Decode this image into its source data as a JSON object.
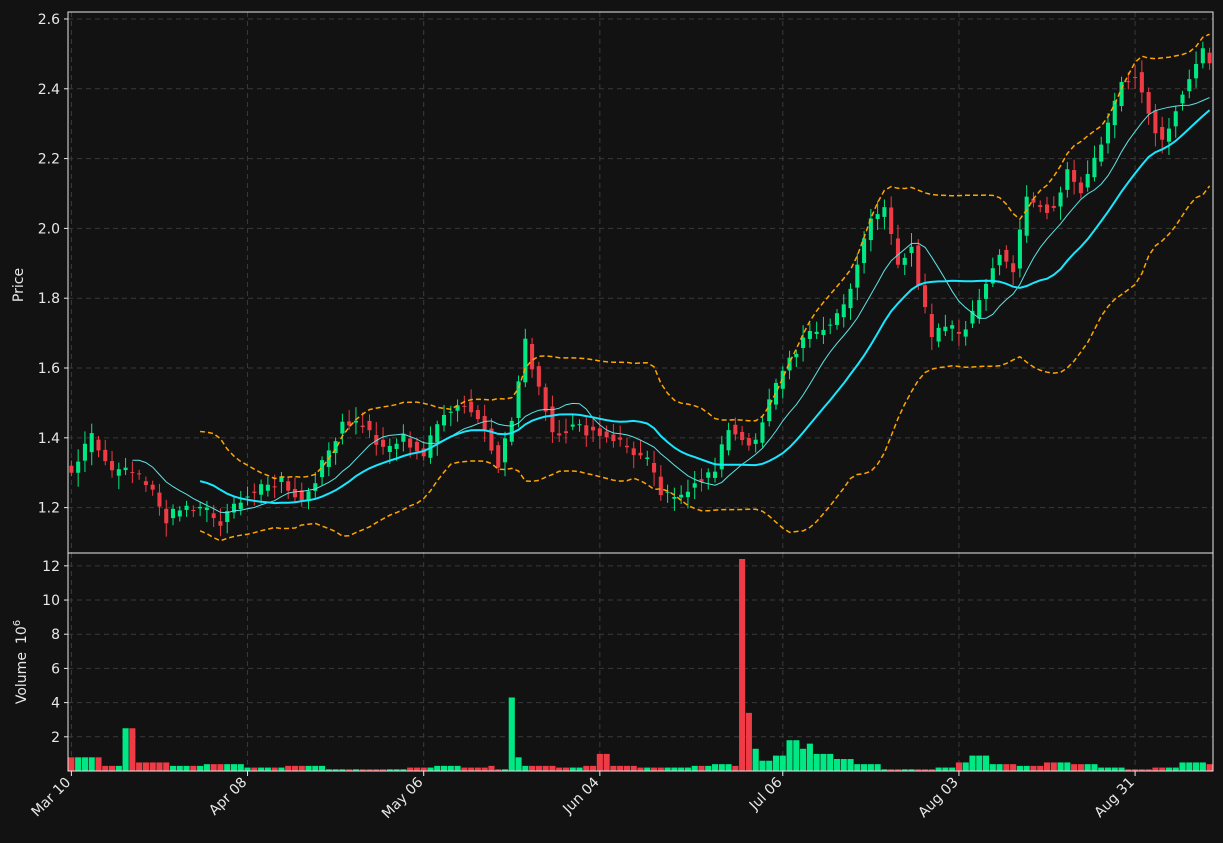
{
  "chart_data": {
    "type": "candlestick",
    "x_tick_labels": [
      "Mar 10",
      "Apr 08",
      "May 06",
      "Jun 04",
      "Jul 06",
      "Aug 03",
      "Aug 31"
    ],
    "price_panel": {
      "ylabel": "Price",
      "ylim": [
        1.07,
        2.62
      ],
      "yticks": [
        1.2,
        1.4,
        1.6,
        1.8,
        2.0,
        2.2,
        2.4,
        2.6
      ],
      "grid": true
    },
    "volume_panel": {
      "ylabel": "Volume",
      "scale_label": "10",
      "scale_exponent": "6",
      "ylim": [
        0,
        12.4
      ],
      "yticks": [
        2,
        4,
        6,
        8,
        10,
        12
      ],
      "grid": true
    },
    "colors": {
      "background": "#121212",
      "up": "#00e884",
      "down": "#ef3b45",
      "ma_fast": "#5ce4e4",
      "ma_slow": "#18e7ff",
      "bollinger": "#ffa500",
      "grid": "#3a3a3a",
      "axis": "#e8e8e8"
    },
    "anchors": {
      "close": [
        [
          0,
          1.3
        ],
        [
          3,
          1.4
        ],
        [
          6,
          1.3
        ],
        [
          9,
          1.3
        ],
        [
          12,
          1.24
        ],
        [
          14,
          1.17
        ],
        [
          17,
          1.2
        ],
        [
          20,
          1.19
        ],
        [
          22,
          1.15
        ],
        [
          25,
          1.23
        ],
        [
          28,
          1.25
        ],
        [
          31,
          1.28
        ],
        [
          34,
          1.22
        ],
        [
          37,
          1.32
        ],
        [
          40,
          1.45
        ],
        [
          43,
          1.44
        ],
        [
          46,
          1.36
        ],
        [
          49,
          1.4
        ],
        [
          52,
          1.35
        ],
        [
          55,
          1.48
        ],
        [
          58,
          1.5
        ],
        [
          61,
          1.43
        ],
        [
          63,
          1.33
        ],
        [
          65,
          1.45
        ],
        [
          67,
          1.67
        ],
        [
          69,
          1.55
        ],
        [
          71,
          1.42
        ],
        [
          74,
          1.43
        ],
        [
          77,
          1.42
        ],
        [
          80,
          1.4
        ],
        [
          83,
          1.36
        ],
        [
          85,
          1.33
        ],
        [
          87,
          1.24
        ],
        [
          89,
          1.22
        ],
        [
          92,
          1.28
        ],
        [
          95,
          1.3
        ],
        [
          97,
          1.43
        ],
        [
          99,
          1.4
        ],
        [
          101,
          1.38
        ],
        [
          103,
          1.5
        ],
        [
          105,
          1.6
        ],
        [
          108,
          1.68
        ],
        [
          110,
          1.7
        ],
        [
          112,
          1.73
        ],
        [
          114,
          1.78
        ],
        [
          116,
          1.9
        ],
        [
          118,
          2.02
        ],
        [
          120,
          2.06
        ],
        [
          122,
          1.9
        ],
        [
          124,
          1.96
        ],
        [
          125,
          1.84
        ],
        [
          127,
          1.68
        ],
        [
          129,
          1.72
        ],
        [
          131,
          1.7
        ],
        [
          133,
          1.75
        ],
        [
          135,
          1.85
        ],
        [
          137,
          1.94
        ],
        [
          139,
          1.88
        ],
        [
          141,
          2.08
        ],
        [
          143,
          2.06
        ],
        [
          145,
          2.06
        ],
        [
          147,
          2.17
        ],
        [
          149,
          2.11
        ],
        [
          151,
          2.2
        ],
        [
          153,
          2.3
        ],
        [
          155,
          2.42
        ],
        [
          157,
          2.45
        ],
        [
          159,
          2.33
        ],
        [
          161,
          2.25
        ],
        [
          163,
          2.35
        ],
        [
          165,
          2.43
        ],
        [
          167,
          2.5
        ],
        [
          168,
          2.46
        ]
      ],
      "volume_millions": [
        [
          0,
          0.8
        ],
        [
          5,
          0.3
        ],
        [
          8,
          2.5
        ],
        [
          10,
          0.5
        ],
        [
          15,
          0.3
        ],
        [
          20,
          0.4
        ],
        [
          26,
          0.2
        ],
        [
          32,
          0.3
        ],
        [
          38,
          0.1
        ],
        [
          46,
          0.1
        ],
        [
          50,
          0.2
        ],
        [
          54,
          0.3
        ],
        [
          58,
          0.2
        ],
        [
          62,
          0.3
        ],
        [
          63,
          0.1
        ],
        [
          65,
          4.3
        ],
        [
          66,
          0.8
        ],
        [
          67,
          0.3
        ],
        [
          72,
          0.2
        ],
        [
          76,
          0.3
        ],
        [
          78,
          1.0
        ],
        [
          80,
          0.3
        ],
        [
          84,
          0.2
        ],
        [
          88,
          0.2
        ],
        [
          92,
          0.3
        ],
        [
          95,
          0.4
        ],
        [
          98,
          0.3
        ],
        [
          99,
          12.4
        ],
        [
          100,
          3.4
        ],
        [
          101,
          1.3
        ],
        [
          102,
          0.6
        ],
        [
          104,
          0.9
        ],
        [
          106,
          1.8
        ],
        [
          108,
          1.3
        ],
        [
          109,
          1.6
        ],
        [
          110,
          1.0
        ],
        [
          113,
          0.7
        ],
        [
          116,
          0.4
        ],
        [
          120,
          0.1
        ],
        [
          125,
          0.1
        ],
        [
          128,
          0.2
        ],
        [
          131,
          0.5
        ],
        [
          133,
          0.9
        ],
        [
          136,
          0.4
        ],
        [
          140,
          0.3
        ],
        [
          144,
          0.5
        ],
        [
          148,
          0.4
        ],
        [
          152,
          0.2
        ],
        [
          156,
          0.1
        ],
        [
          160,
          0.2
        ],
        [
          164,
          0.5
        ],
        [
          168,
          0.4
        ]
      ]
    }
  }
}
